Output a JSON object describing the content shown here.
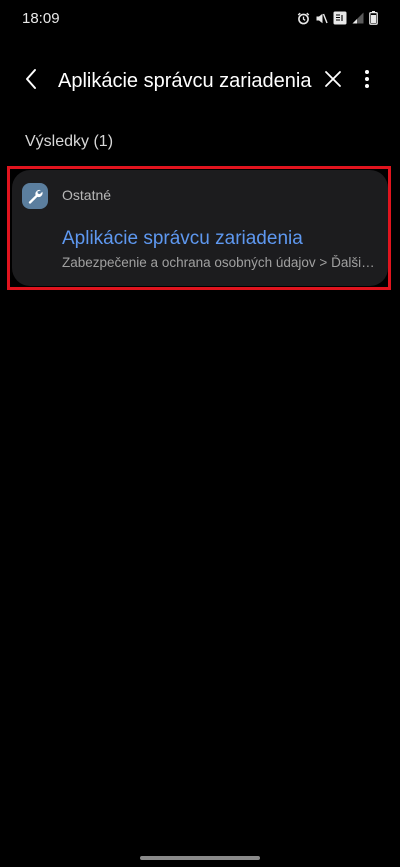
{
  "status_bar": {
    "time": "18:09",
    "icons": [
      "alarm-icon",
      "mute-icon",
      "vowifi-icon",
      "signal-icon",
      "battery-icon"
    ]
  },
  "search": {
    "query": "Aplikácie správcu zariadenia",
    "back_icon": "chevron-left-icon",
    "clear_icon": "close-icon",
    "more_icon": "more-vert-icon"
  },
  "results": {
    "label": "Výsledky (1)",
    "items": [
      {
        "category": "Ostatné",
        "category_icon": "wrench-icon",
        "title": "Aplikácie správcu zariadenia",
        "path": "Zabezpečenie a ochrana osobných údajov > Ďalšie nastavenia zabezpečenia"
      }
    ]
  },
  "colors": {
    "background": "#000000",
    "card": "#1c1c1e",
    "accent_link": "#5e98f0",
    "highlight": "#e0141e",
    "category_icon_bg": "#5b7e9e"
  }
}
